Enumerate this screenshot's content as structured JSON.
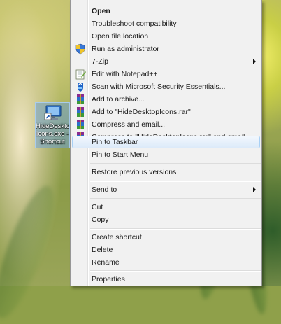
{
  "desktop_icon": {
    "label": "HideDeskto\nIcons.exe -\nShortcut"
  },
  "context_menu": {
    "items": [
      {
        "label": "Open",
        "bold": true
      },
      {
        "label": "Troubleshoot compatibility"
      },
      {
        "label": "Open file location"
      },
      {
        "label": "Run as administrator",
        "icon": "uac-shield-icon"
      },
      {
        "label": "7-Zip",
        "submenu": true
      },
      {
        "label": "Edit with Notepad++",
        "icon": "notepadpp-icon"
      },
      {
        "label": "Scan with Microsoft Security Essentials...",
        "icon": "security-essentials-icon"
      },
      {
        "label": "Add to archive...",
        "icon": "winrar-icon"
      },
      {
        "label": "Add to \"HideDesktopIcons.rar\"",
        "icon": "winrar-icon"
      },
      {
        "label": "Compress and email...",
        "icon": "winrar-icon"
      },
      {
        "label": "Compress to \"HideDesktopIcons.rar\" and email",
        "icon": "winrar-icon"
      },
      {
        "label": "Pin to Taskbar",
        "highlighted": true
      },
      {
        "label": "Pin to Start Menu"
      },
      {
        "label": "Restore previous versions"
      },
      {
        "label": "Send to",
        "submenu": true
      },
      {
        "label": "Cut"
      },
      {
        "label": "Copy"
      },
      {
        "label": "Create shortcut"
      },
      {
        "label": "Delete"
      },
      {
        "label": "Rename"
      },
      {
        "label": "Properties"
      }
    ]
  }
}
